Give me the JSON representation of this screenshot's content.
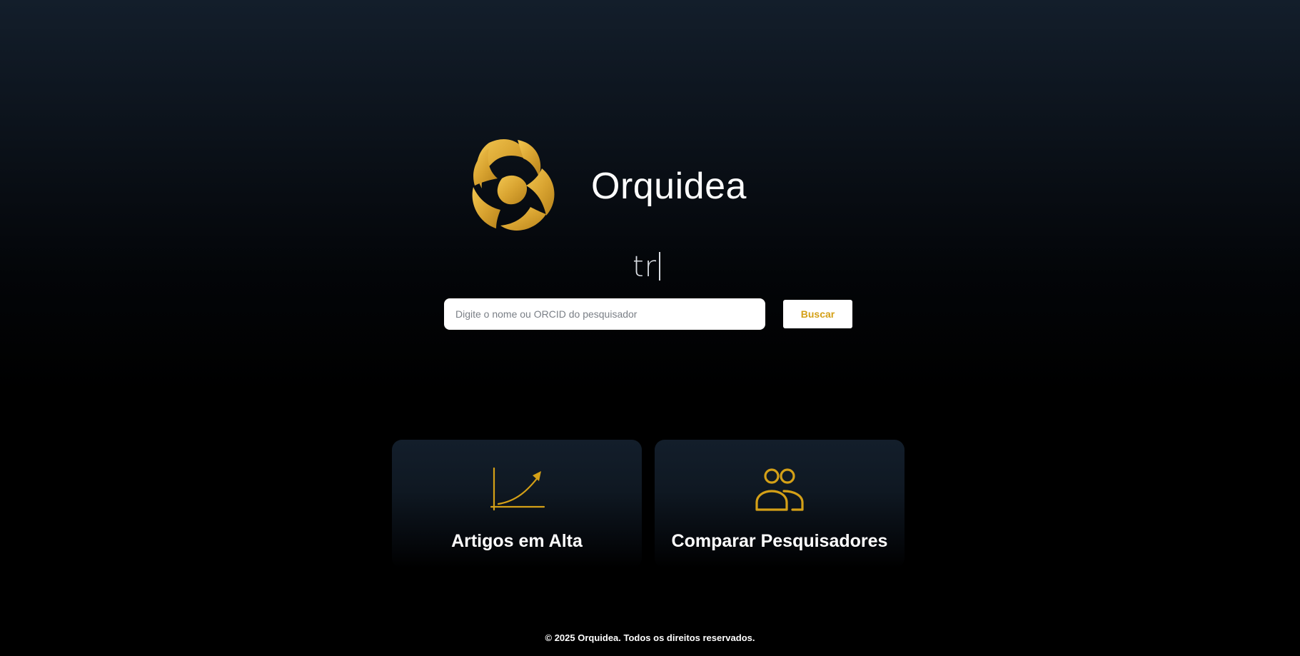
{
  "brand": {
    "name": "Orquidea",
    "logo_icon": "golden-swirl-flower-logo",
    "accent_color": "#d4a017"
  },
  "hero": {
    "typed_text": "tr"
  },
  "search": {
    "placeholder": "Digite o nome ou ORCID do pesquisador",
    "value": "",
    "button_label": "Buscar"
  },
  "cards": [
    {
      "title": "Artigos em Alta",
      "icon": "trending-chart-icon"
    },
    {
      "title": "Comparar Pesquisadores",
      "icon": "users-icon"
    }
  ],
  "footer": {
    "text": "© 2025 Orquidea. Todos os direitos reservados."
  }
}
